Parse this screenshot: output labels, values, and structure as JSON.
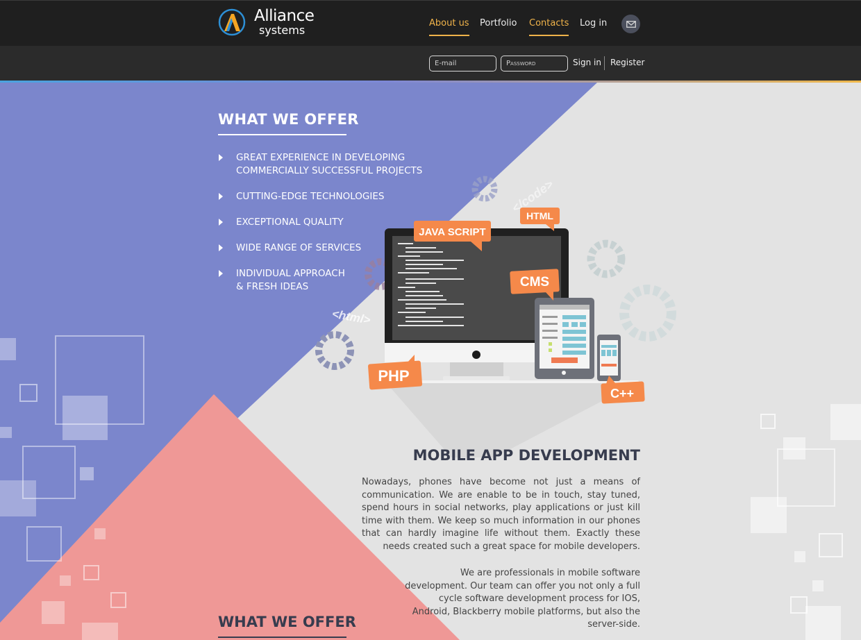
{
  "colors": {
    "header": "#1f1f1f",
    "subheader": "#2b2b2b",
    "accent": "#f0b34a",
    "blue": "#7b86cc",
    "pink": "#ef9896",
    "orange": "#f5894a",
    "dark": "#373c4e"
  },
  "brand": {
    "line1": "Alliance",
    "line2": "systems"
  },
  "nav": {
    "items": [
      {
        "label": "About us",
        "active": true
      },
      {
        "label": "Portfolio",
        "active": false
      },
      {
        "label": "Contacts",
        "active": true
      },
      {
        "label": "Log in",
        "active": false
      }
    ],
    "mail_icon": "envelope-icon"
  },
  "auth": {
    "email_placeholder": "E-mail",
    "password_placeholder": "Password",
    "signin_label": "Sign in",
    "register_label": "Register"
  },
  "offer": {
    "title": "WHAT WE OFFER",
    "items": [
      {
        "line1": "GREAT EXPERIENCE IN DEVELOPING",
        "line2": "COMMERCIALLY SUCCESSFUL PROJECTS"
      },
      {
        "line1": "CUTTING-EDGE TECHNOLOGIES",
        "line2": ""
      },
      {
        "line1": "EXCEPTIONAL QUALITY",
        "line2": ""
      },
      {
        "line1": "WIDE RANGE OF SERVICES",
        "line2": ""
      },
      {
        "line1": "INDIVIDUAL APPROACH",
        "line2": "& FRESH IDEAS"
      }
    ]
  },
  "illustration": {
    "tags": {
      "js": "JAVA SCRIPT",
      "html": "HTML",
      "cms": "CMS",
      "php": "PHP",
      "cpp": "C++"
    },
    "floating": {
      "code": "</code>",
      "html": "<html>"
    }
  },
  "mobile": {
    "title": "MOBILE APP DEVELOPMENT",
    "p1": "Nowadays, phones have become not just a means of communication. We are enable to be in touch, stay tuned, spend hours in social networks, play applications or just kill time with them. We keep so much information in our phones that can hardly imagine life without them. Exactly these needs created such a great space for mobile developers.",
    "p2": "We are professionals in mobile software development. Our team can offer you not only a full cycle software development process for IOS, Android, Blackberry mobile platforms, but also the server-side."
  },
  "offer2": {
    "title": "WHAT WE OFFER"
  }
}
